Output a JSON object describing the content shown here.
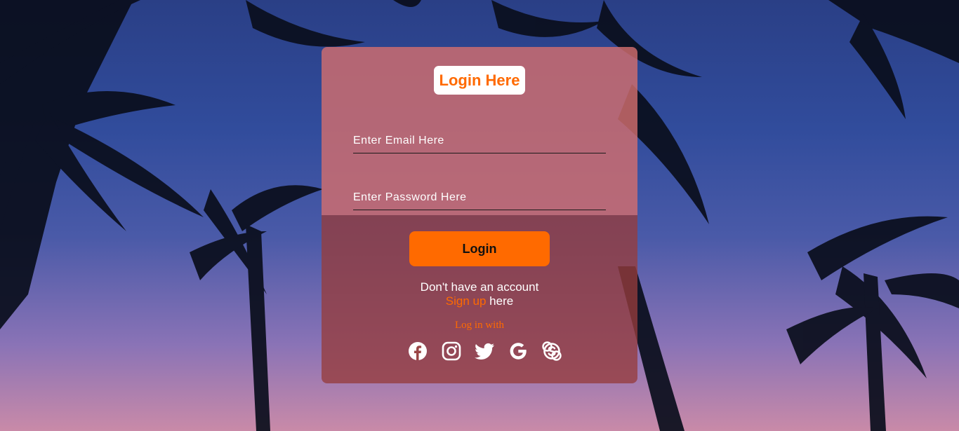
{
  "form": {
    "title": "Login Here",
    "email_placeholder": "Enter Email Here",
    "password_placeholder": "Enter Password Here",
    "login_label": "Login",
    "account_prompt": "Don't have an account",
    "signup_link": "Sign up",
    "signup_suffix": " here",
    "login_with": "Log in with"
  },
  "social_icons": [
    "facebook-icon",
    "instagram-icon",
    "twitter-icon",
    "google-icon",
    "skype-icon"
  ],
  "colors": {
    "accent": "#ff6a00",
    "card_top": "#d26e6e",
    "card_bottom": "#963c3c",
    "text": "#ffffff"
  }
}
